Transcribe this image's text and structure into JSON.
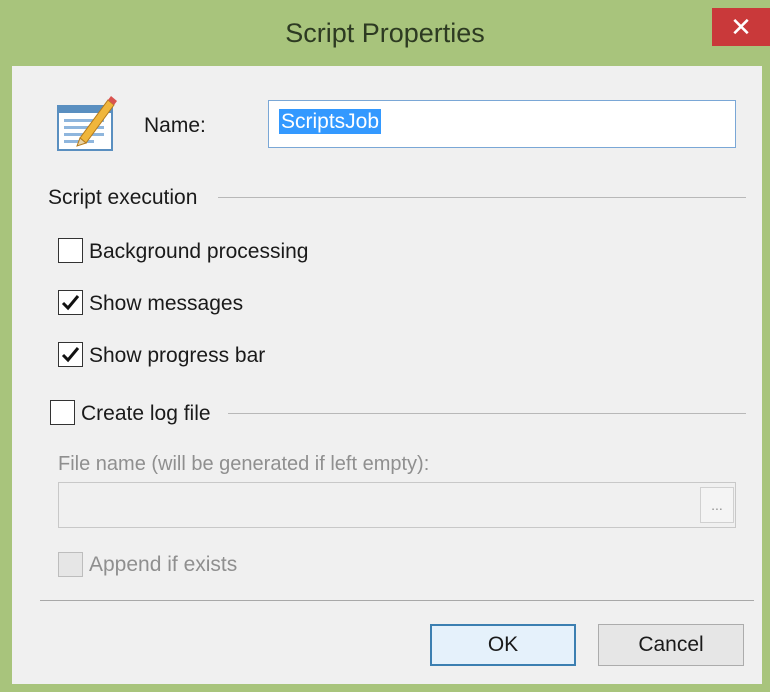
{
  "window": {
    "title": "Script Properties",
    "close_glyph": "✕",
    "accent_color": "#a8c47c"
  },
  "name_field": {
    "label": "Name:",
    "value": "ScriptsJob"
  },
  "script_execution": {
    "group_label": "Script execution",
    "background_processing": {
      "label": "Background processing",
      "checked": false
    },
    "show_messages": {
      "label": "Show messages",
      "checked": true
    },
    "show_progress_bar": {
      "label": "Show progress bar",
      "checked": true
    }
  },
  "log_file": {
    "label": "Create log file",
    "checked": false,
    "file_name_label": "File name (will be generated if left empty):",
    "file_name_value": "",
    "browse_label": "...",
    "append_label": "Append if exists",
    "append_checked": false
  },
  "buttons": {
    "ok": "OK",
    "cancel": "Cancel"
  },
  "icons": {
    "app": "script-edit-icon",
    "checkmark": "checkmark-icon"
  }
}
